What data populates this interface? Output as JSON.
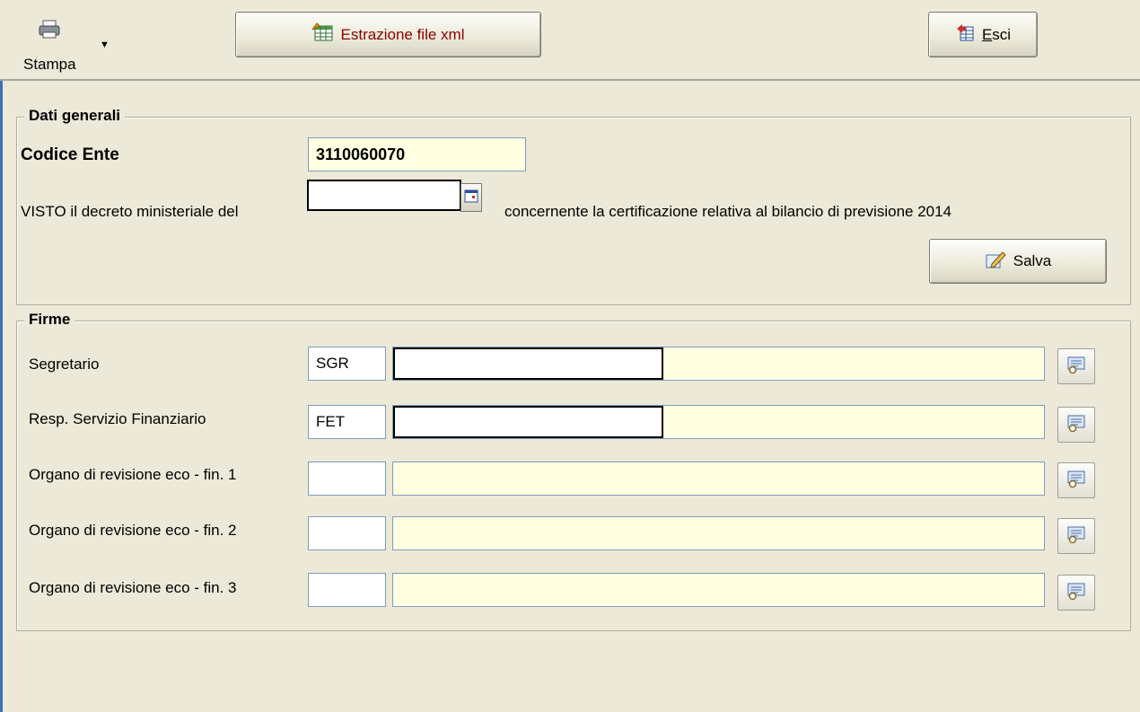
{
  "toolbar": {
    "stampa_label": "Stampa",
    "xml_button_label": "Estrazione file xml",
    "exit_button_label": "Esci"
  },
  "dati_generali": {
    "title": "Dati generali",
    "codice_ente_label": "Codice Ente",
    "codice_ente_value": "3110060070",
    "visto_label": "VISTO il decreto ministeriale del",
    "concernente_label": "concernente la certificazione relativa al bilancio di previsione 2014",
    "save_button_label": "Salva"
  },
  "firme": {
    "title": "Firme",
    "rows": [
      {
        "label": "Segretario",
        "code": "SGR",
        "name": ""
      },
      {
        "label": "Resp. Servizio Finanziario",
        "code": "FET",
        "name": ""
      },
      {
        "label": "Organo di revisione eco - fin. 1",
        "code": "",
        "name": ""
      },
      {
        "label": "Organo di revisione eco - fin. 2",
        "code": "",
        "name": ""
      },
      {
        "label": "Organo di revisione eco - fin. 3",
        "code": "",
        "name": ""
      }
    ]
  },
  "icons": {
    "printer": "printer-icon",
    "xml": "spreadsheet-icon",
    "exit": "exit-door-icon",
    "calendar": "calendar-icon",
    "save": "pencil-save-icon",
    "lookup": "lookup-icon"
  },
  "colors": {
    "background": "#ece9d8",
    "input_yellow": "#ffffe1",
    "xml_text": "#8b0000",
    "window_accent": "#3e6fc1"
  }
}
